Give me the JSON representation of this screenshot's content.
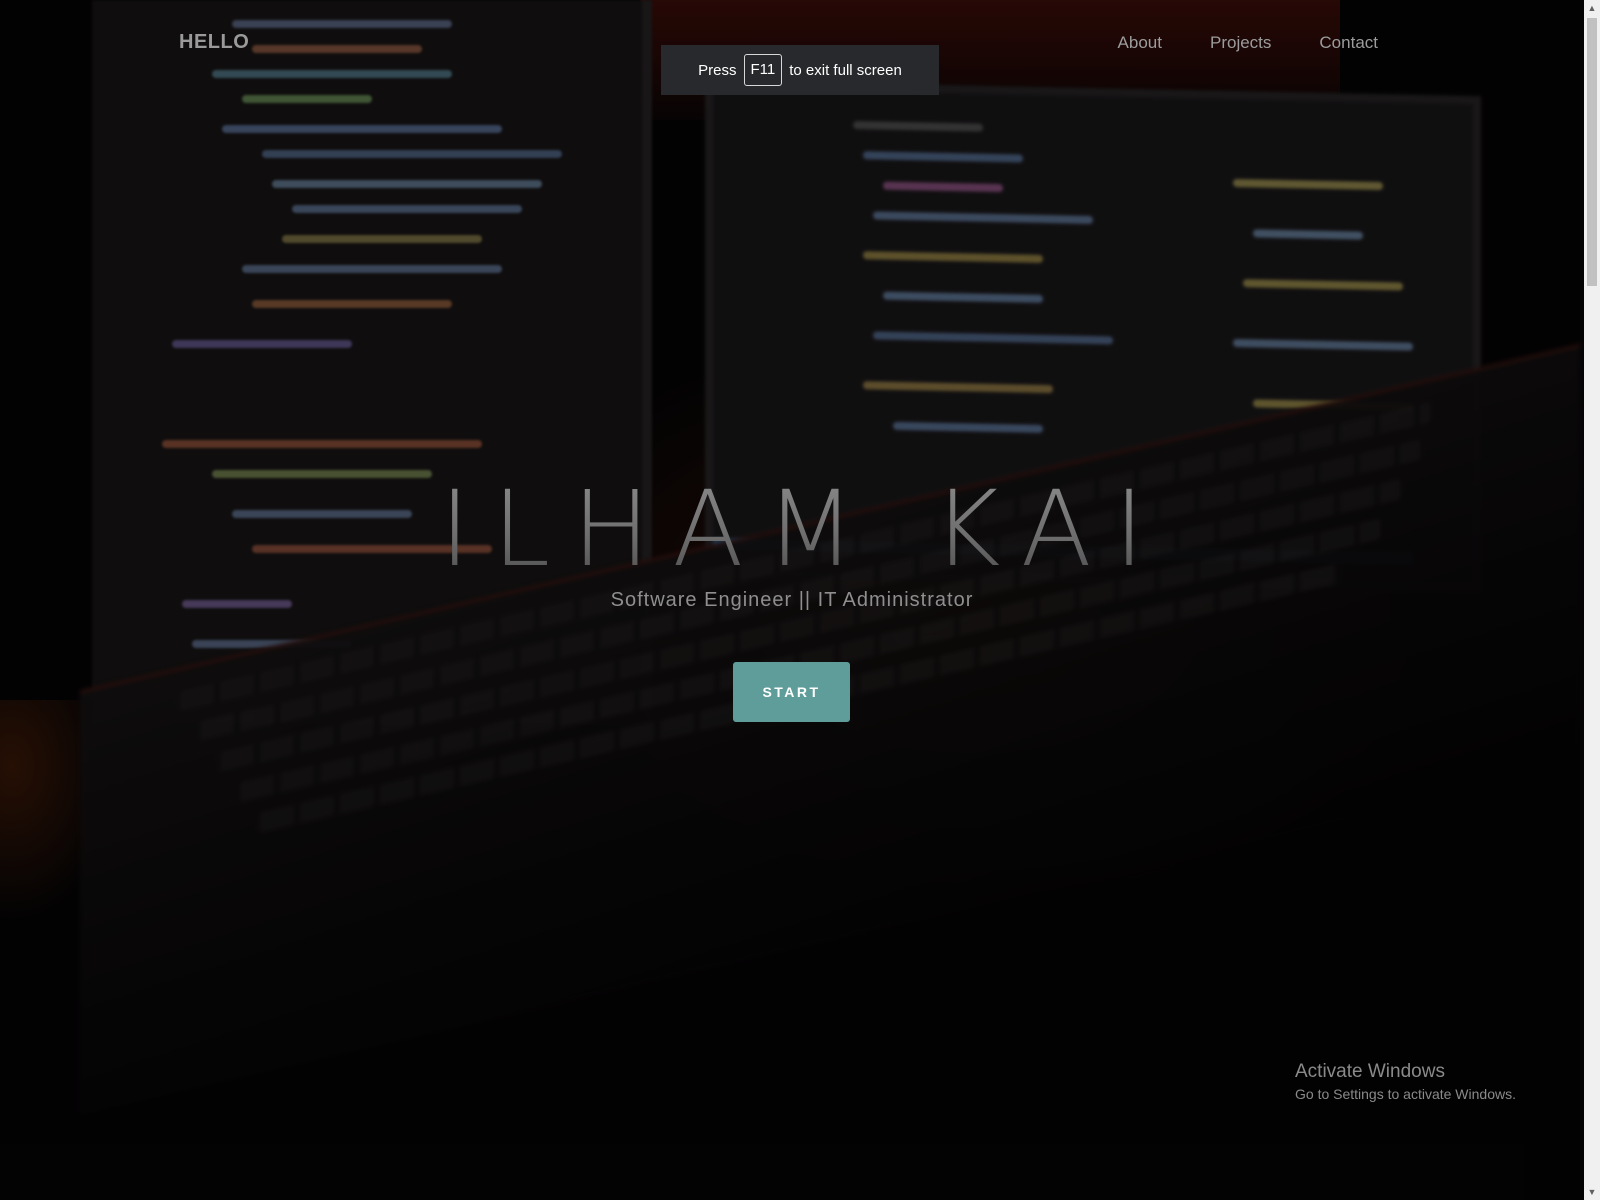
{
  "nav": {
    "brand": "HELLO",
    "links": [
      "About",
      "Projects",
      "Contact"
    ]
  },
  "fullscreen_notice": {
    "prefix": "Press",
    "key": "F11",
    "suffix": "to exit full screen"
  },
  "hero": {
    "title": "ILHAM KAI",
    "subtitle": "Software Engineer || IT Administrator",
    "button": "START"
  },
  "watermark": {
    "title": "Activate Windows",
    "subtitle": "Go to Settings to activate Windows."
  },
  "colors": {
    "accent": "#5f9d9a",
    "background": "#060506"
  },
  "icons": {
    "scroll_up": "triangle-up-icon",
    "scroll_down": "triangle-down-icon"
  }
}
